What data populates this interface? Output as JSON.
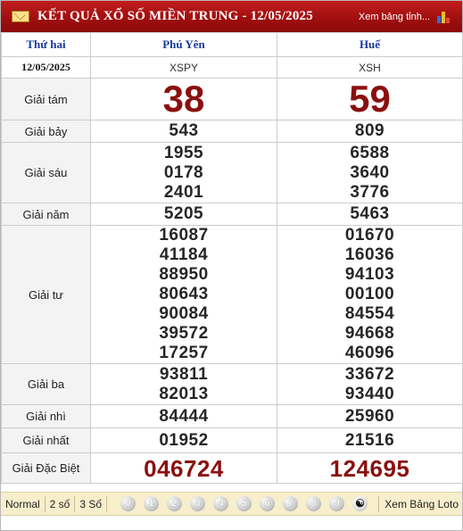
{
  "header": {
    "title": "KẾT QUẢ XỔ SỐ MIỀN TRUNG - 12/05/2025",
    "more_link": "Xem bảng tỉnh..."
  },
  "table": {
    "day": "Thứ hai",
    "date": "12/05/2025",
    "provinces": [
      {
        "name": "Phú Yên",
        "code": "XSPY"
      },
      {
        "name": "Huế",
        "code": "XSH"
      }
    ],
    "prizes": {
      "g8": {
        "label": "Giải tám",
        "values": [
          "38",
          "59"
        ]
      },
      "g7": {
        "label": "Giải bảy",
        "values": [
          "543",
          "809"
        ]
      },
      "g6": {
        "label": "Giải sáu",
        "values": [
          [
            "1955",
            "0178",
            "2401"
          ],
          [
            "6588",
            "3640",
            "3776"
          ]
        ]
      },
      "g5": {
        "label": "Giải năm",
        "values": [
          "5205",
          "5463"
        ]
      },
      "g4": {
        "label": "Giải tư",
        "values": [
          [
            "16087",
            "41184",
            "88950",
            "80643",
            "90084",
            "39572",
            "17257"
          ],
          [
            "01670",
            "16036",
            "94103",
            "00100",
            "84554",
            "94668",
            "46096"
          ]
        ]
      },
      "g3": {
        "label": "Giải ba",
        "values": [
          [
            "93811",
            "82013"
          ],
          [
            "33672",
            "93440"
          ]
        ]
      },
      "g2": {
        "label": "Giải nhì",
        "values": [
          "84444",
          "25960"
        ]
      },
      "g1": {
        "label": "Giải nhất",
        "values": [
          "01952",
          "21516"
        ]
      },
      "db": {
        "label": "Giải Đặc Biệt",
        "values": [
          "046724",
          "124695"
        ]
      }
    }
  },
  "footer": {
    "options": [
      "Normal",
      "2 số",
      "3 Số"
    ],
    "digits": [
      "0",
      "1",
      "2",
      "3",
      "4",
      "5",
      "6",
      "7",
      "8",
      "9"
    ],
    "tail_icon": "yin-yang-icon",
    "tail_glyph": "☯",
    "loto_link": "Xem Bảng Loto"
  },
  "colors": {
    "header_red": "#a10f0f",
    "number_red": "#8b0f0f",
    "province_blue": "#1a3a9c",
    "footer_bg": "#f7eecb"
  }
}
